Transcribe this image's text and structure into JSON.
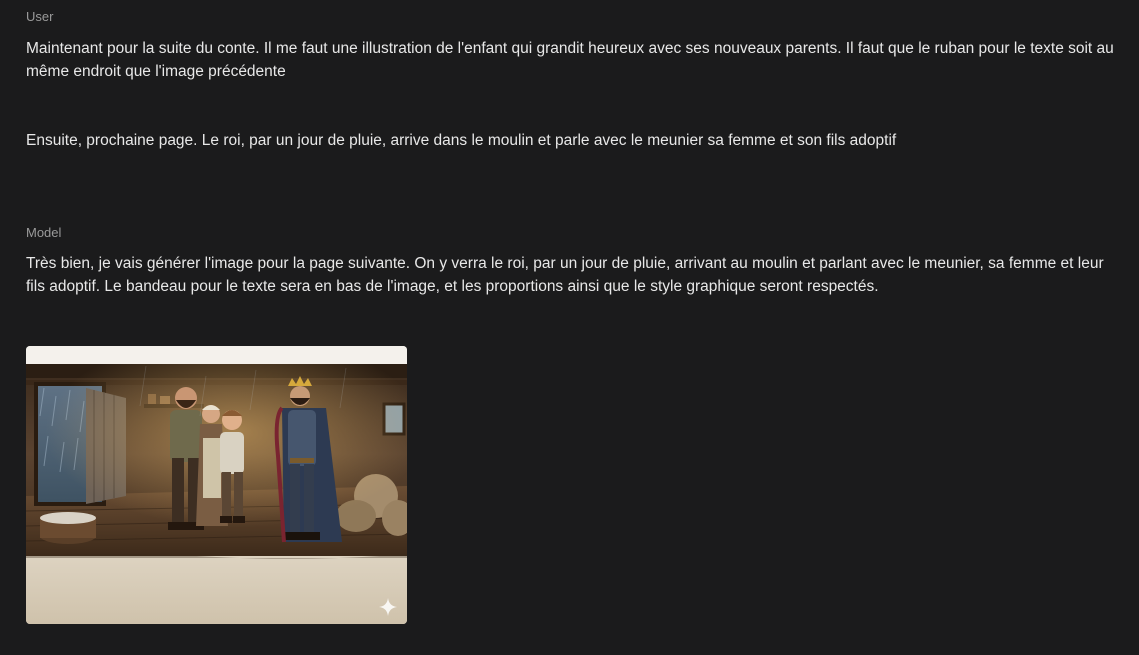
{
  "conversation": {
    "user": {
      "role_label": "User",
      "paragraphs": [
        "Maintenant pour la suite du conte. Il me faut une illustration de l'enfant qui grandit heureux avec ses nouveaux parents. Il faut que le ruban pour le texte soit au même endroit que l'image précédente",
        "Ensuite, prochaine page. Le roi, par un jour de pluie, arrive dans le moulin et parle avec le meunier sa femme et son fils adoptif"
      ]
    },
    "model": {
      "role_label": "Model",
      "paragraphs": [
        "Très bien, je vais générer l'image pour la page suivante. On y verra le roi, par un jour de pluie, arrivant au moulin et parlant avec le meunier, sa femme et leur fils adoptif. Le bandeau pour le texte sera en bas de l'image, et les proportions ainsi que le style graphique seront respectés."
      ],
      "image": {
        "icon": "sparkle-icon"
      }
    }
  }
}
